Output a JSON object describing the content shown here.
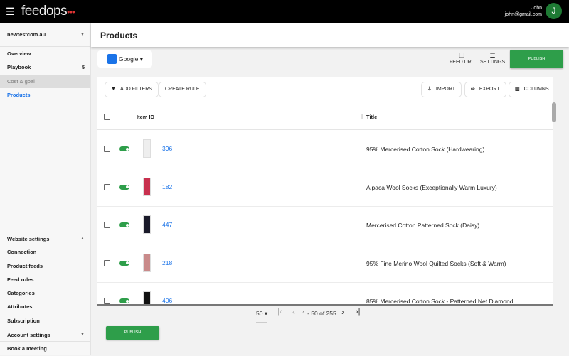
{
  "topbar": {
    "logo": "feedops",
    "user_name": "John",
    "user_email": "john@gmail.com",
    "avatar_letter": "J"
  },
  "sidebar": {
    "account": "newtestcom.au",
    "items": [
      {
        "label": "Overview"
      },
      {
        "label": "Playbook",
        "badge": "5"
      },
      {
        "label": "Cost & goal"
      },
      {
        "label": "Products"
      }
    ],
    "website_settings": "Website settings",
    "settings_items": [
      "Connection",
      "Product feeds",
      "Feed rules",
      "Categories",
      "Attributes",
      "Subscription"
    ],
    "account_settings": "Account settings",
    "book_meeting": "Book a meeting"
  },
  "header": {
    "title": "Products"
  },
  "toolbar": {
    "channel": "Google",
    "feed_url": "FEED URL",
    "settings": "SETTINGS",
    "publish": "PUBLISH"
  },
  "actions": {
    "add_filters": "ADD FILTERS",
    "create_rule": "CREATE RULE",
    "import": "IMPORT",
    "export": "EXPORT",
    "columns": "COLUMNS"
  },
  "table": {
    "columns": [
      "Item ID",
      "Title"
    ],
    "rows": [
      {
        "id": "396",
        "title": "95% Mercerised Cotton Sock (Hardwearing)",
        "enabled": true,
        "thumb_color": "#eeeeee"
      },
      {
        "id": "182",
        "title": "Alpaca Wool Socks (Exceptionally Warm Luxury)",
        "enabled": true,
        "thumb_color": "#c8304e"
      },
      {
        "id": "447",
        "title": "Mercerised Cotton Patterned Sock (Daisy)",
        "enabled": true,
        "thumb_color": "#1a1a2a"
      },
      {
        "id": "218",
        "title": "95% Fine Merino Wool Quilted Socks (Soft & Warm)",
        "enabled": true,
        "thumb_color": "#c98a8a"
      },
      {
        "id": "406",
        "title": "85% Mercerised Cotton Sock - Patterned Net Diamond",
        "enabled": true,
        "thumb_color": "#111111"
      }
    ]
  },
  "pagination": {
    "page_size": "50",
    "range": "1 - 50 of 255"
  },
  "footer": {
    "publish": "PUBLISH"
  },
  "colors": {
    "accent": "#1a73e8",
    "publish": "#2e9e4a"
  }
}
